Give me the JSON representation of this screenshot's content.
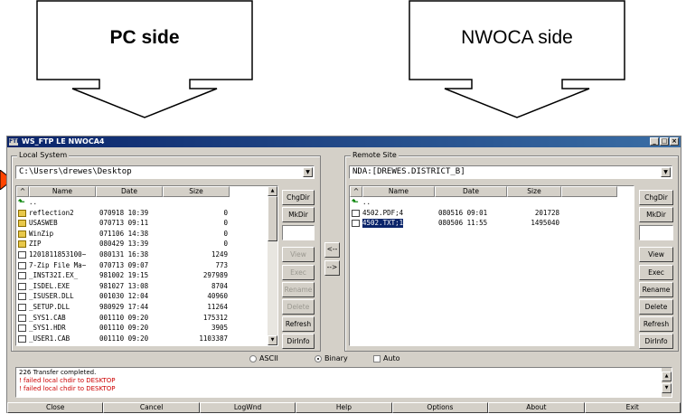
{
  "callouts": {
    "left": "PC side",
    "right": "NWOCA side"
  },
  "window": {
    "title": "WS_FTP LE NWOCA4",
    "title_icon": "ftp-app-icon",
    "controls": [
      "_",
      "□",
      "×"
    ]
  },
  "local": {
    "group_label": "Local System",
    "path": "C:\\Users\\drewes\\Desktop",
    "columns": [
      "^",
      "Name",
      "Date",
      "Size"
    ],
    "rows": [
      {
        "icon": "up",
        "name": "..",
        "date": "",
        "size": ""
      },
      {
        "icon": "folder",
        "name": "reflection2",
        "date": "070918 10:39",
        "size": "0"
      },
      {
        "icon": "folder",
        "name": "USASWEB",
        "date": "070713 09:11",
        "size": "0"
      },
      {
        "icon": "folder",
        "name": "WinZip",
        "date": "071106 14:38",
        "size": "0"
      },
      {
        "icon": "folder",
        "name": "ZIP",
        "date": "080429 13:39",
        "size": "0"
      },
      {
        "icon": "file",
        "name": "1201811853100~",
        "date": "080131 16:38",
        "size": "1249"
      },
      {
        "icon": "file",
        "name": "7-Zip File Ma~",
        "date": "070713 09:07",
        "size": "773"
      },
      {
        "icon": "file",
        "name": "_INST32I.EX_",
        "date": "981002 19:15",
        "size": "297989"
      },
      {
        "icon": "file",
        "name": "_ISDEL.EXE",
        "date": "981027 13:08",
        "size": "8704"
      },
      {
        "icon": "file",
        "name": "_ISUSER.DLL",
        "date": "001030 12:04",
        "size": "40960"
      },
      {
        "icon": "file",
        "name": "_SETUP.DLL",
        "date": "980929 17:44",
        "size": "11264"
      },
      {
        "icon": "file",
        "name": "_SYS1.CAB",
        "date": "001110 09:20",
        "size": "175312"
      },
      {
        "icon": "file",
        "name": "_SYS1.HDR",
        "date": "001110 09:20",
        "size": "3905"
      },
      {
        "icon": "file",
        "name": "_USER1.CAB",
        "date": "001110 09:20",
        "size": "1103387"
      }
    ],
    "buttons": {
      "chgdir": "ChgDir",
      "mkdir": "MkDir",
      "view": "View",
      "exec": "Exec",
      "rename": "Rename",
      "delete": "Delete",
      "refresh": "Refresh",
      "dirinfo": "DirInfo"
    }
  },
  "transfer": {
    "to_local": "<--",
    "to_remote": "-->"
  },
  "remote": {
    "group_label": "Remote Site",
    "path": "NDA:[DREWES.DISTRICT_B]",
    "columns": [
      "^",
      "Name",
      "Date",
      "Size"
    ],
    "rows": [
      {
        "icon": "up",
        "name": "..",
        "date": "",
        "size": "",
        "selected": false
      },
      {
        "icon": "file",
        "name": "4502.PDF;4",
        "date": "080516 09:01",
        "size": "201728",
        "selected": false
      },
      {
        "icon": "file",
        "name": "4502.TXT;1",
        "date": "080506 11:55",
        "size": "1495040",
        "selected": true
      }
    ],
    "buttons": {
      "chgdir": "ChgDir",
      "mkdir": "MkDir",
      "view": "View",
      "exec": "Exec",
      "rename": "Rename",
      "delete": "Delete",
      "refresh": "Refresh",
      "dirinfo": "DirInfo"
    }
  },
  "mode": {
    "ascii": "ASCII",
    "binary": "Binary",
    "auto": "Auto",
    "selected": "binary",
    "auto_checked": false
  },
  "log": {
    "lines": [
      {
        "text": "226 Transfer completed.",
        "color": "#000000"
      },
      {
        "text": "! failed local chdir to DESKTOP",
        "color": "#cc0000"
      },
      {
        "text": "! failed local chdir to DESKTOP",
        "color": "#cc0000"
      }
    ]
  },
  "bottom_buttons": [
    "Close",
    "Cancel",
    "LogWnd",
    "Help",
    "Options",
    "About",
    "Exit"
  ],
  "colors": {
    "title_gradient_start": "#0a246a",
    "title_gradient_end": "#3a6ea5",
    "window_bg": "#d4d0c8",
    "selection": "#0a246a",
    "arrow_marker": "#ff4500"
  }
}
